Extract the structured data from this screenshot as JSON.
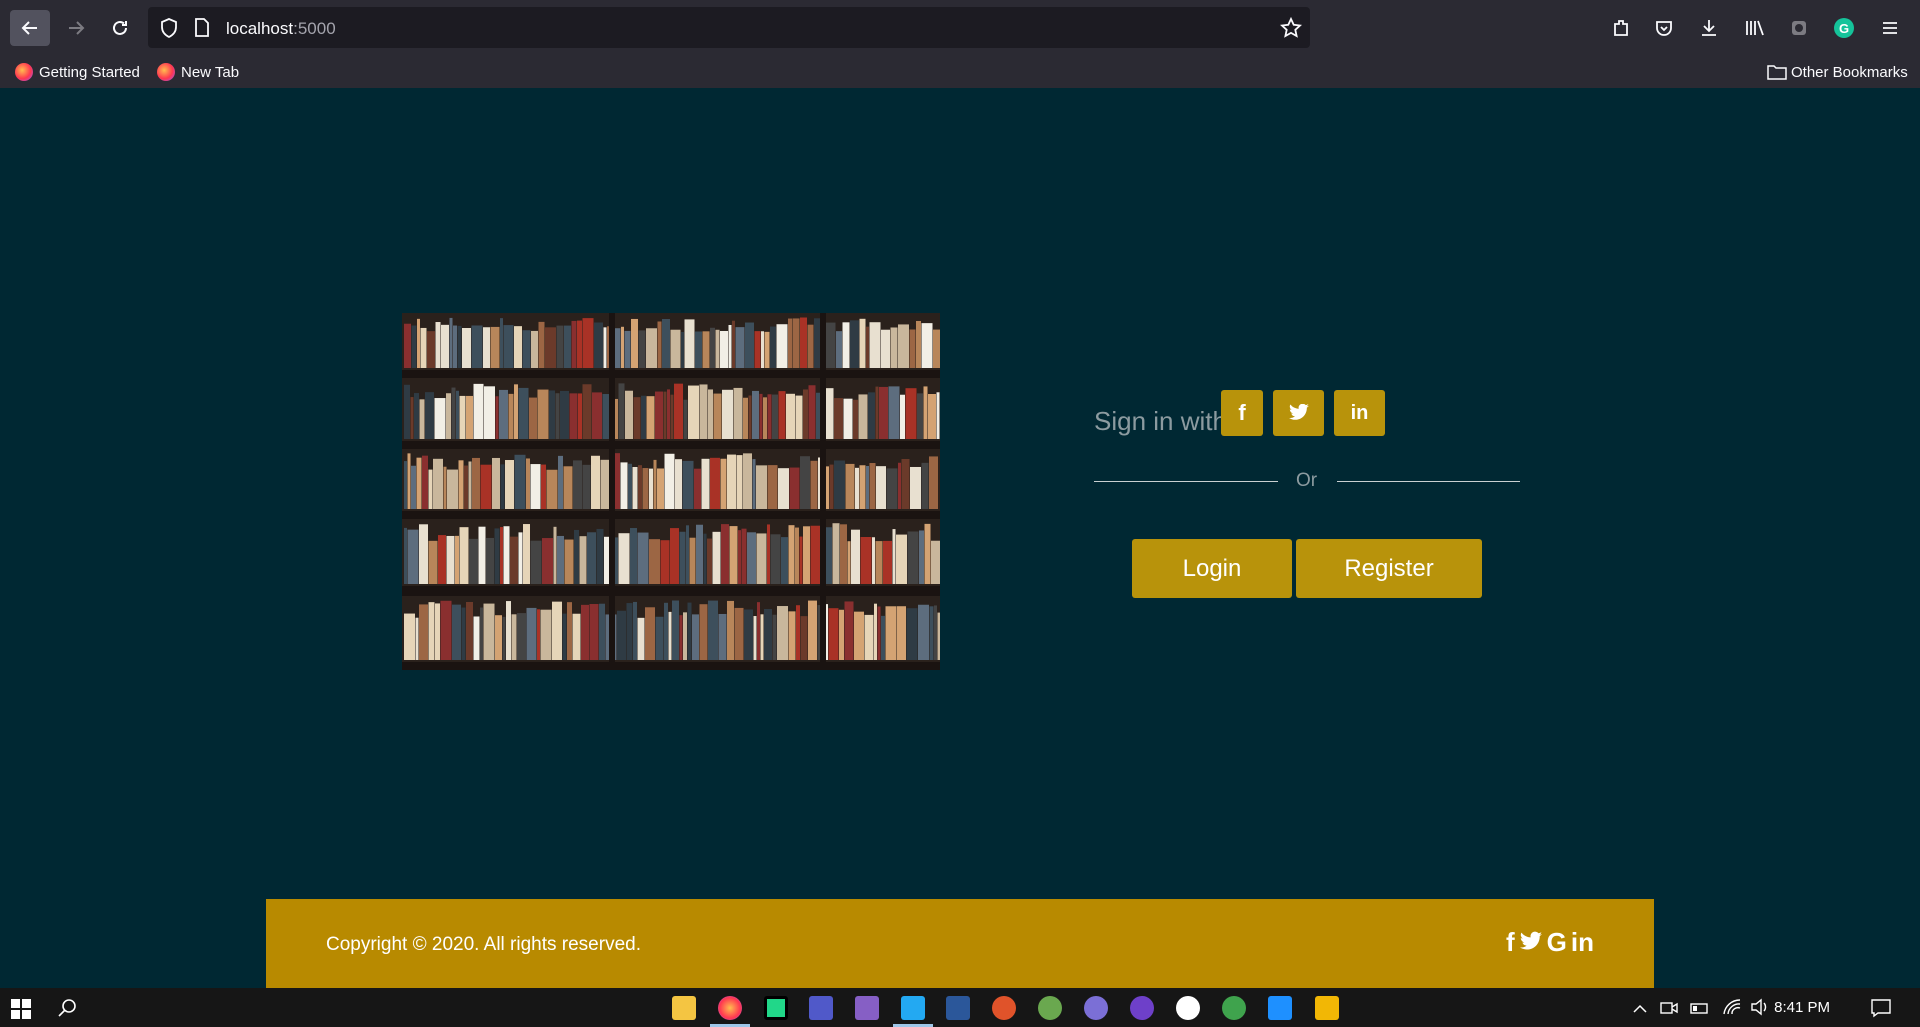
{
  "browser": {
    "url_host": "localhost",
    "url_port": ":5000",
    "bookmarks": [
      {
        "label": "Getting Started"
      },
      {
        "label": "New Tab"
      }
    ],
    "other_bookmarks": "Other Bookmarks"
  },
  "auth": {
    "signin_label": "Sign in with",
    "social": [
      {
        "icon": "facebook-icon",
        "glyph": "f"
      },
      {
        "icon": "twitter-icon",
        "glyph": "🐦"
      },
      {
        "icon": "linkedin-icon",
        "glyph": "in"
      }
    ],
    "or_label": "Or",
    "login_label": "Login",
    "register_label": "Register"
  },
  "footer": {
    "copyright": "Copyright © 2020. All rights reserved.",
    "icons": [
      "facebook-icon",
      "twitter-icon",
      "google-icon",
      "linkedin-icon"
    ]
  },
  "taskbar": {
    "time": "8:41 PM"
  },
  "colors": {
    "page_bg": "#002833",
    "accent": "#b8930b",
    "footer": "#b88a00"
  }
}
